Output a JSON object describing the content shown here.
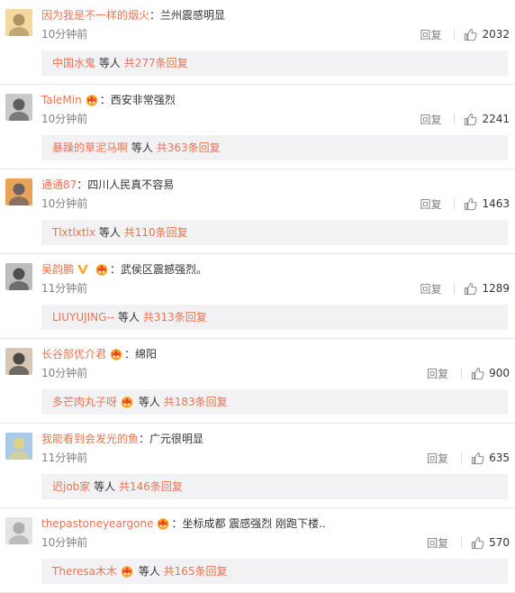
{
  "comments": [
    {
      "username": "因为我是不一样的烟火",
      "badge": "none",
      "text": "：兰州震感明显",
      "time": "10分钟前",
      "reply_label": "回复",
      "likes": "2032",
      "replies": {
        "user": "中国水鬼",
        "user_badge": "none",
        "others": "等人",
        "total": "共277条回复"
      },
      "avatar_colors": [
        "#f3d9a0",
        "#9a7b4f"
      ]
    },
    {
      "username": "TaleMin",
      "badge": "member-crown",
      "text": "：西安非常强烈",
      "time": "10分钟前",
      "reply_label": "回复",
      "likes": "2241",
      "replies": {
        "user": "暴躁的草泥马啊",
        "user_badge": "none",
        "others": "等人",
        "total": "共363条回复"
      },
      "avatar_colors": [
        "#c9c9c9",
        "#3a3a3a"
      ]
    },
    {
      "username": "通通87",
      "badge": "none",
      "text": "：四川人民真不容易",
      "time": "10分钟前",
      "reply_label": "回复",
      "likes": "1463",
      "replies": {
        "user": "Tlxtlxtlx",
        "user_badge": "none",
        "others": "等人",
        "total": "共110条回复"
      },
      "avatar_colors": [
        "#e8a35a",
        "#3d4b6b"
      ]
    },
    {
      "username": "吴韵鹏",
      "badge": "verified-v+member-crown",
      "text": "：武侯区震撼强烈。",
      "time": "11分钟前",
      "reply_label": "回复",
      "likes": "1289",
      "replies": {
        "user": "LIUYUJING--",
        "user_badge": "none",
        "others": "等人",
        "total": "共313条回复"
      },
      "avatar_colors": [
        "#bdbdbd",
        "#2b2b2b"
      ]
    },
    {
      "username": "长谷部优介君",
      "badge": "member-crown",
      "text": "：绵阳",
      "time": "10分钟前",
      "reply_label": "回复",
      "likes": "900",
      "replies": {
        "user": "多芒肉丸子呀",
        "user_badge": "member-crown",
        "others": "等人",
        "total": "共183条回复"
      },
      "avatar_colors": [
        "#d8c7b5",
        "#1e1e1e"
      ]
    },
    {
      "username": "我能看到会发光的鱼",
      "badge": "none",
      "text": "：广元很明显",
      "time": "11分钟前",
      "reply_label": "回复",
      "likes": "635",
      "replies": {
        "user": "迟job家",
        "user_badge": "none",
        "others": "等人",
        "total": "共146条回复"
      },
      "avatar_colors": [
        "#a9c9e8",
        "#f0d36b"
      ]
    },
    {
      "username": "thepastoneyeargone",
      "badge": "member-crown",
      "text": "：坐标成都 震感强烈 刚跑下楼..",
      "time": "10分钟前",
      "reply_label": "回复",
      "likes": "570",
      "replies": {
        "user": "Theresa木木",
        "user_badge": "member-crown",
        "others": "等人",
        "total": "共165条回复"
      },
      "avatar_colors": [
        "#e4e4e4",
        "#9b9b9b"
      ]
    }
  ],
  "colors": {
    "link": "#eb7350",
    "meta": "#808080",
    "reply_bg": "#f2f2f5"
  },
  "icons": {
    "like": "thumbs-up-icon",
    "member": "crown-badge-icon",
    "verified": "verified-v-icon"
  }
}
